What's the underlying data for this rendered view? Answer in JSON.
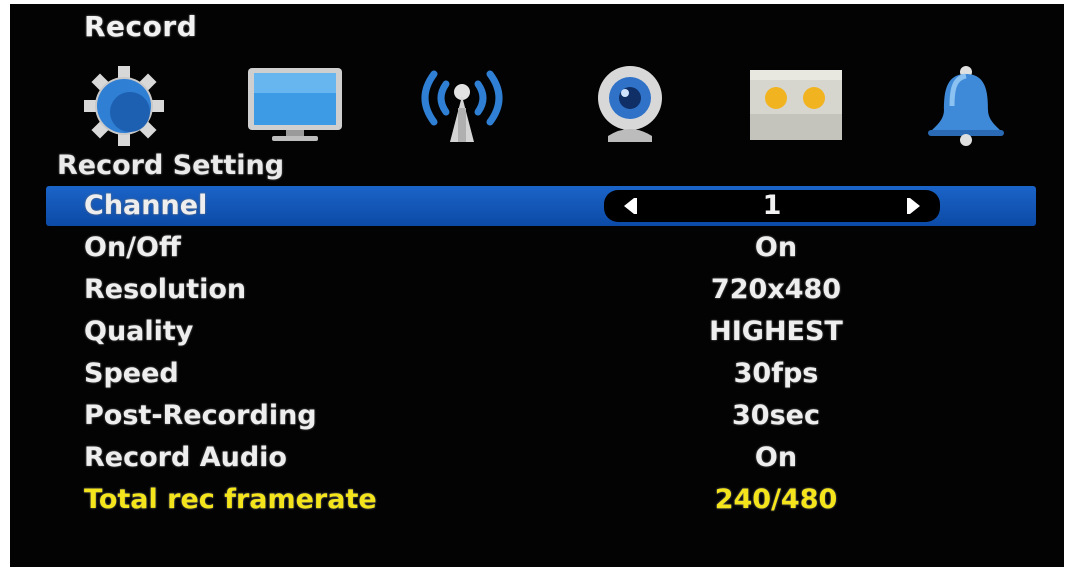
{
  "header": {
    "title": "Record"
  },
  "toolbar": {
    "icons": [
      {
        "name": "gear-icon"
      },
      {
        "name": "monitor-icon"
      },
      {
        "name": "network-antenna-icon"
      },
      {
        "name": "webcam-icon"
      },
      {
        "name": "storage-device-icon"
      },
      {
        "name": "bell-icon"
      }
    ]
  },
  "section": {
    "title": "Record Setting"
  },
  "settings": {
    "channel": {
      "label": "Channel",
      "value": "1"
    },
    "on_off": {
      "label": "On/Off",
      "value": "On"
    },
    "resolution": {
      "label": "Resolution",
      "value": "720x480"
    },
    "quality": {
      "label": "Quality",
      "value": "HIGHEST"
    },
    "speed": {
      "label": "Speed",
      "value": "30fps"
    },
    "post_recording": {
      "label": "Post-Recording",
      "value": "30sec"
    },
    "record_audio": {
      "label": "Record Audio",
      "value": "On"
    },
    "total_rec_framerate": {
      "label": "Total rec framerate",
      "value": "240/480"
    }
  },
  "colors": {
    "background": "#030303",
    "selection": "#1558bb",
    "text": "#eeeeee",
    "highlight_text": "#f4e41c"
  }
}
